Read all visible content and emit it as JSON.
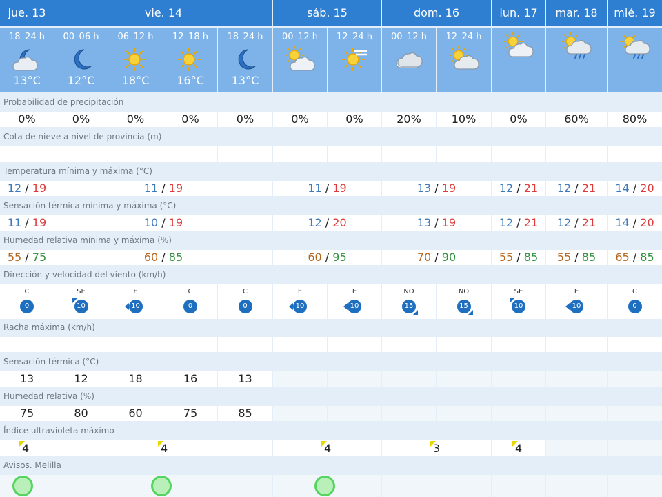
{
  "days": [
    {
      "label": "jue. 13",
      "span": [
        0,
        0
      ]
    },
    {
      "label": "vie. 14",
      "span": [
        1,
        4
      ]
    },
    {
      "label": "sáb. 15",
      "span": [
        5,
        6
      ]
    },
    {
      "label": "dom. 16",
      "span": [
        7,
        8
      ]
    },
    {
      "label": "lun. 17",
      "span": [
        9,
        9
      ]
    },
    {
      "label": "mar. 18",
      "span": [
        10,
        10
      ]
    },
    {
      "label": "mié. 19",
      "span": [
        11,
        11
      ]
    }
  ],
  "periods": [
    {
      "label": "18–24 h",
      "icon": "moon-cloud-icon",
      "temp": "13°C"
    },
    {
      "label": "00–06 h",
      "icon": "moon-icon",
      "temp": "12°C"
    },
    {
      "label": "06–12 h",
      "icon": "sun-icon",
      "temp": "18°C"
    },
    {
      "label": "12–18 h",
      "icon": "sun-icon",
      "temp": "16°C"
    },
    {
      "label": "18–24 h",
      "icon": "moon-icon",
      "temp": "13°C"
    },
    {
      "label": "00–12 h",
      "icon": "sun-cloud-icon",
      "temp": ""
    },
    {
      "label": "12–24 h",
      "icon": "sun-haze-icon",
      "temp": ""
    },
    {
      "label": "00–12 h",
      "icon": "cloud-icon",
      "temp": ""
    },
    {
      "label": "12–24 h",
      "icon": "sun-cloud-heavy-icon",
      "temp": ""
    },
    {
      "label": "",
      "icon": "sun-cloud-icon",
      "temp": ""
    },
    {
      "label": "",
      "icon": "sun-rain-icon",
      "temp": ""
    },
    {
      "label": "",
      "icon": "sun-rain-icon",
      "temp": ""
    }
  ],
  "rows": {
    "precip": {
      "caption": "Probabilidad de precipitación",
      "values": [
        "0%",
        "0%",
        "0%",
        "0%",
        "0%",
        "0%",
        "0%",
        "20%",
        "10%",
        "0%",
        "60%",
        "80%"
      ]
    },
    "snow": {
      "caption": "Cota de nieve a nivel de provincia (m)"
    },
    "temp": {
      "caption": "Temperatura mínima y máxima (°C)",
      "groups": [
        {
          "min": "12",
          "max": "19"
        },
        {
          "min": "11",
          "max": "19"
        },
        {
          "min": "11",
          "max": "19"
        },
        {
          "min": "13",
          "max": "19"
        },
        {
          "min": "12",
          "max": "21"
        },
        {
          "min": "12",
          "max": "21"
        },
        {
          "min": "14",
          "max": "20"
        }
      ]
    },
    "feel": {
      "caption": "Sensación térmica mínima y máxima (°C)",
      "groups": [
        {
          "min": "11",
          "max": "19"
        },
        {
          "min": "10",
          "max": "19"
        },
        {
          "min": "12",
          "max": "20"
        },
        {
          "min": "13",
          "max": "19"
        },
        {
          "min": "12",
          "max": "21"
        },
        {
          "min": "12",
          "max": "21"
        },
        {
          "min": "14",
          "max": "20"
        }
      ]
    },
    "hum": {
      "caption": "Humedad relativa mínima y máxima (%)",
      "groups": [
        {
          "min": "55",
          "max": "75"
        },
        {
          "min": "60",
          "max": "85"
        },
        {
          "min": "60",
          "max": "95"
        },
        {
          "min": "70",
          "max": "90"
        },
        {
          "min": "55",
          "max": "85"
        },
        {
          "min": "55",
          "max": "85"
        },
        {
          "min": "65",
          "max": "85"
        }
      ]
    },
    "wind": {
      "caption": "Dirección y velocidad del viento (km/h)",
      "values": [
        {
          "dir": "C",
          "speed": "0"
        },
        {
          "dir": "SE",
          "speed": "10"
        },
        {
          "dir": "E",
          "speed": "10"
        },
        {
          "dir": "C",
          "speed": "0"
        },
        {
          "dir": "C",
          "speed": "0"
        },
        {
          "dir": "E",
          "speed": "10"
        },
        {
          "dir": "E",
          "speed": "10"
        },
        {
          "dir": "NO",
          "speed": "15"
        },
        {
          "dir": "NO",
          "speed": "15"
        },
        {
          "dir": "SE",
          "speed": "10"
        },
        {
          "dir": "E",
          "speed": "10"
        },
        {
          "dir": "C",
          "speed": "0"
        }
      ]
    },
    "gust": {
      "caption": "Racha máxima (km/h)"
    },
    "feelp": {
      "caption": "Sensación térmica (°C)",
      "values": [
        "13",
        "12",
        "18",
        "16",
        "13"
      ]
    },
    "hump": {
      "caption": "Humedad relativa (%)",
      "values": [
        "75",
        "80",
        "60",
        "75",
        "85"
      ]
    },
    "uv": {
      "caption": "Índice ultravioleta máximo",
      "groups": [
        "4",
        "4",
        "4",
        "3",
        "4"
      ]
    },
    "alerts": {
      "caption": "Avisos. Melilla",
      "level_color": "#55d460"
    }
  },
  "colors": {
    "day_header": "#2e7ed1",
    "period_header": "#7db3e8",
    "wind_badge": "#1f6fc1",
    "uv_flag": "#e8d800"
  }
}
